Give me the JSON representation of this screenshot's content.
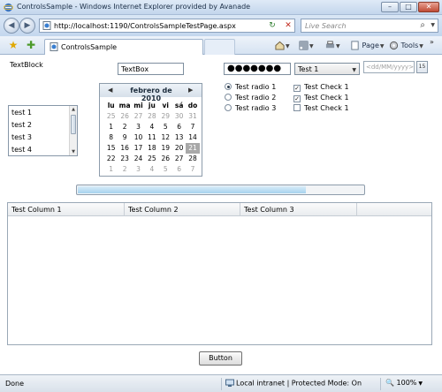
{
  "window": {
    "title": "ControlsSample - Windows Internet Explorer provided by Avanade",
    "minimize": "–",
    "maximize": "□",
    "close": "✕"
  },
  "navbar": {
    "back": "◀",
    "forward": "▶",
    "url": "http://localhost:1190/ControlsSampleTestPage.aspx",
    "refresh": "↻",
    "stop": "✕",
    "search_placeholder": "Live Search",
    "search_icon": "⌕"
  },
  "tabbar": {
    "tab_label": "ControlsSample",
    "page": "Page",
    "tools": "Tools",
    "more": "»"
  },
  "content": {
    "textblock": "TextBlock",
    "textbox_value": "TextBox",
    "password_mask": "●●●●●●●",
    "combo_value": "Test 1",
    "combo_arrow": "▼",
    "date_placeholder": "<dd/MM/yyyy>",
    "date_button": "15",
    "listbox_items": [
      "test 1",
      "test 2",
      "test 3",
      "test 4"
    ],
    "calendar": {
      "month_label": "febrero de 2010",
      "prev": "◀",
      "next": "▶",
      "weekdays": [
        "lu",
        "ma",
        "mi",
        "ju",
        "vi",
        "sá",
        "do"
      ],
      "weeks": [
        [
          "25",
          "26",
          "27",
          "28",
          "29",
          "30",
          "31"
        ],
        [
          "1",
          "2",
          "3",
          "4",
          "5",
          "6",
          "7"
        ],
        [
          "8",
          "9",
          "10",
          "11",
          "12",
          "13",
          "14"
        ],
        [
          "15",
          "16",
          "17",
          "18",
          "19",
          "20",
          "21"
        ],
        [
          "22",
          "23",
          "24",
          "25",
          "26",
          "27",
          "28"
        ],
        [
          "1",
          "2",
          "3",
          "4",
          "5",
          "6",
          "7"
        ]
      ],
      "today": "21"
    },
    "radios": [
      {
        "label": "Test radio 1",
        "checked": true
      },
      {
        "label": "Test radio 2",
        "checked": false
      },
      {
        "label": "Test radio 3",
        "checked": false
      }
    ],
    "checks": [
      {
        "label": "Test Check 1",
        "checked": true
      },
      {
        "label": "Test Check 1",
        "checked": true
      },
      {
        "label": "Test Check 1",
        "checked": false
      }
    ],
    "progress_value": 0.8,
    "grid_columns": [
      "Test Column 1",
      "Test Column 2",
      "Test Column 3"
    ],
    "button_label": "Button"
  },
  "status": {
    "text": "Done",
    "zone": "Local intranet | Protected Mode: On",
    "zoom": "100%"
  },
  "colors": {
    "chrome": "#bcd0e6",
    "progress_fill": "#a6d2ee",
    "today_highlight": "#a8a8a8"
  }
}
